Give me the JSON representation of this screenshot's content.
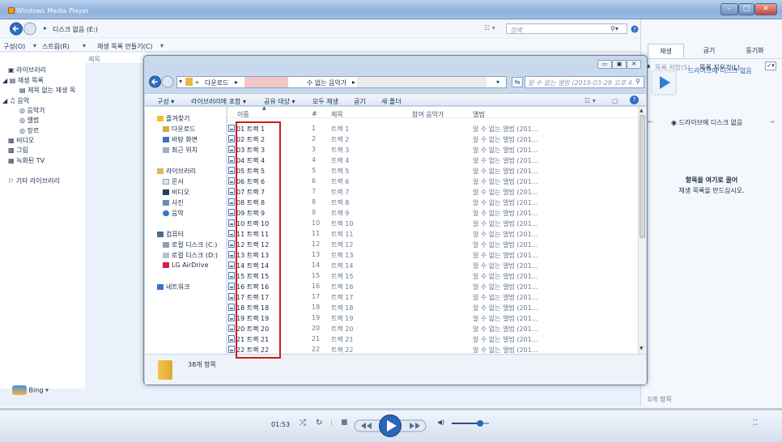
{
  "wmp": {
    "title": "Windows Media Player",
    "breadcrumb": "디스크 없음 (E:)",
    "search_placeholder": "검색",
    "menu": [
      "구성(O)",
      "스트림(R)",
      "재생 목록 만들기(C)"
    ],
    "column_header": "제목",
    "tabs": [
      "재생",
      "굽기",
      "동기화"
    ],
    "save_list": "목록 저장(S)",
    "clear_list": "목록 지우기(L)",
    "drive_notice_top": "드라이브에 디스크 없음",
    "drive_notice": "드라이브에 디스크 없음",
    "drag_hint_1": "항목을 여기로 끌어",
    "drag_hint_2": "재생 목록을 만드십시오.",
    "item_count": "0개 항목",
    "bing": "Bing",
    "time": "01:53",
    "library_tree": [
      "라이브러리",
      "재생 목록",
      "제목 없는 재생 목",
      "음악",
      "음악가",
      "앨범",
      "장르",
      "비디오",
      "그림",
      "녹화된 TV",
      "기타 라이브러리"
    ],
    "volume_percent": 75
  },
  "explorer": {
    "path_prefix": "«",
    "path_1": "다운로드",
    "path_2": "수 없는 음악가",
    "search_placeholder": "알 수 없는 앨범 (2019-03-29 오후 4...",
    "toolbar": [
      "구성 ▾",
      "라이브러리에 포함 ▾",
      "공유 대상 ▾",
      "모두 재생",
      "굽기",
      "새 폴더"
    ],
    "columns": [
      "이름",
      "#",
      "제목",
      "참여 음악가",
      "앨범"
    ],
    "nav": {
      "favorites": "즐겨찾기",
      "downloads": "다운로드",
      "desktop": "바탕 화면",
      "recent": "최근 위치",
      "libraries": "라이브러리",
      "documents": "문서",
      "videos": "비디오",
      "pictures": "사진",
      "music": "음악",
      "computer": "컴퓨터",
      "disk_c": "로컬 디스크 (C:)",
      "disk_d": "로컬 디스크 (D:)",
      "airdrive": "LG AirDrive",
      "network": "네트워크"
    },
    "files": [
      {
        "name": "01 트랙 1",
        "num": "1",
        "title": "트랙 1",
        "album": "알 수 없는 앨범 (201..."
      },
      {
        "name": "02 트랙 2",
        "num": "2",
        "title": "트랙 2",
        "album": "알 수 없는 앨범 (201..."
      },
      {
        "name": "03 트랙 3",
        "num": "3",
        "title": "트랙 3",
        "album": "알 수 없는 앨범 (201..."
      },
      {
        "name": "04 트랙 4",
        "num": "4",
        "title": "트랙 4",
        "album": "알 수 없는 앨범 (201..."
      },
      {
        "name": "05 트랙 5",
        "num": "5",
        "title": "트랙 5",
        "album": "알 수 없는 앨범 (201..."
      },
      {
        "name": "06 트랙 6",
        "num": "6",
        "title": "트랙 6",
        "album": "알 수 없는 앨범 (201..."
      },
      {
        "name": "07 트랙 7",
        "num": "7",
        "title": "트랙 7",
        "album": "알 수 없는 앨범 (201..."
      },
      {
        "name": "08 트랙 8",
        "num": "8",
        "title": "트랙 8",
        "album": "알 수 없는 앨범 (201..."
      },
      {
        "name": "09 트랙 9",
        "num": "9",
        "title": "트랙 9",
        "album": "알 수 없는 앨범 (201..."
      },
      {
        "name": "10 트랙 10",
        "num": "10",
        "title": "트랙 10",
        "album": "알 수 없는 앨범 (201..."
      },
      {
        "name": "11 트랙 11",
        "num": "11",
        "title": "트랙 11",
        "album": "알 수 없는 앨범 (201..."
      },
      {
        "name": "12 트랙 12",
        "num": "12",
        "title": "트랙 12",
        "album": "알 수 없는 앨범 (201..."
      },
      {
        "name": "13 트랙 13",
        "num": "13",
        "title": "트랙 13",
        "album": "알 수 없는 앨범 (201..."
      },
      {
        "name": "14 트랙 14",
        "num": "14",
        "title": "트랙 14",
        "album": "알 수 없는 앨범 (201..."
      },
      {
        "name": "15 트랙 15",
        "num": "15",
        "title": "트랙 15",
        "album": "알 수 없는 앨범 (201..."
      },
      {
        "name": "16 트랙 16",
        "num": "16",
        "title": "트랙 16",
        "album": "알 수 없는 앨범 (201..."
      },
      {
        "name": "17 트랙 17",
        "num": "17",
        "title": "트랙 17",
        "album": "알 수 없는 앨범 (201..."
      },
      {
        "name": "18 트랙 18",
        "num": "18",
        "title": "트랙 18",
        "album": "알 수 없는 앨범 (201..."
      },
      {
        "name": "19 트랙 19",
        "num": "19",
        "title": "트랙 19",
        "album": "알 수 없는 앨범 (201..."
      },
      {
        "name": "20 트랙 20",
        "num": "20",
        "title": "트랙 20",
        "album": "알 수 없는 앨범 (201..."
      },
      {
        "name": "21 트랙 21",
        "num": "21",
        "title": "트랙 21",
        "album": "알 수 없는 앨범 (201..."
      },
      {
        "name": "22 트랙 22",
        "num": "22",
        "title": "트랙 22",
        "album": "알 수 없는 앨범 (201..."
      }
    ],
    "status_count": "38개 항목"
  }
}
